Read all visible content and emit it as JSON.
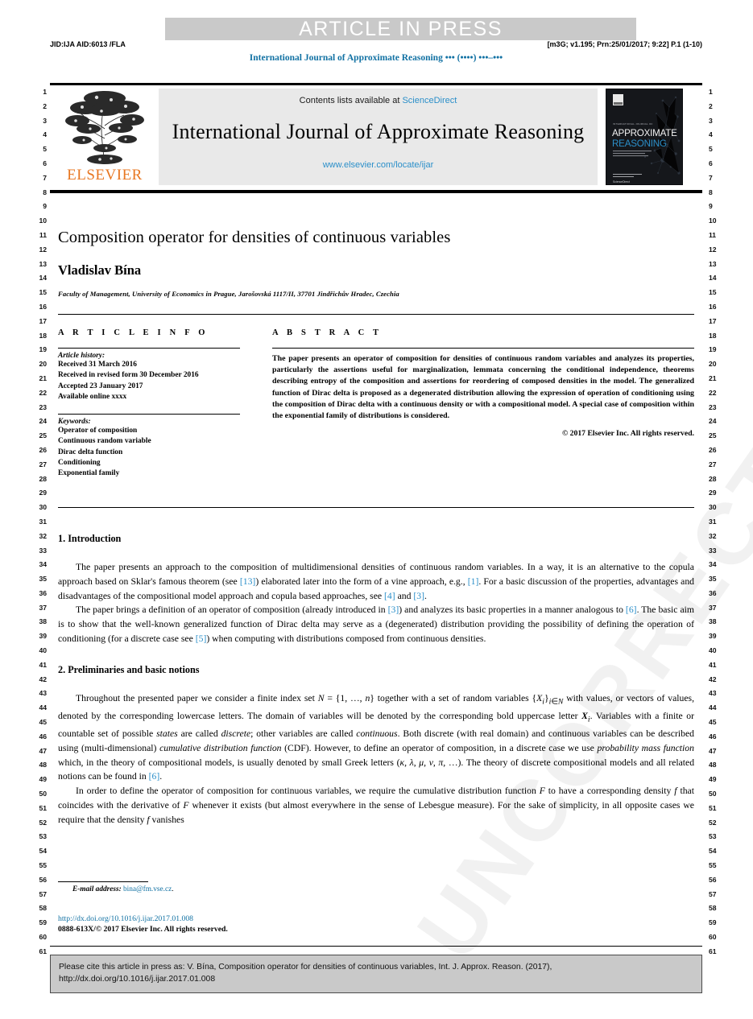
{
  "banner": {
    "text": "ARTICLE IN PRESS"
  },
  "proof_header": {
    "left": "JID:IJA   AID:6013 /FLA",
    "right": "[m3G; v1.195; Prn:25/01/2017; 9:22] P.1 (1-10)"
  },
  "journal_reference": "International Journal of Approximate Reasoning ••• (••••) •••–•••",
  "masthead": {
    "publisher": "ELSEVIER",
    "contents_prefix": "Contents lists available at ",
    "contents_link": "ScienceDirect",
    "journal_title": "International Journal of Approximate Reasoning",
    "journal_url": "www.elsevier.com/locate/ijar",
    "cover": {
      "title_line1": "APPROXIMATE",
      "title_line2": "REASONING",
      "top_label": "INTERNATIONAL JOURNAL OF"
    }
  },
  "line_numbers": {
    "first": 1,
    "last": 61
  },
  "article": {
    "title": "Composition operator for densities of continuous variables",
    "author": "Vladislav Bína",
    "affiliation": "Faculty of Management, University of Economics in Prague, Jarošovská 1117/II, 37701 Jindřichův Hradec, Czechia"
  },
  "article_info": {
    "heading": "A R T I C L E   I N F O",
    "history_label": "Article history:",
    "history": [
      "Received 31 March 2016",
      "Received in revised form 30 December 2016",
      "Accepted 23 January 2017",
      "Available online xxxx"
    ],
    "keywords_label": "Keywords:",
    "keywords": [
      "Operator of composition",
      "Continuous random variable",
      "Dirac delta function",
      "Conditioning",
      "Exponential family"
    ]
  },
  "abstract": {
    "heading": "A B S T R A C T",
    "text": "The paper presents an operator of composition for densities of continuous random variables and analyzes its properties, particularly the assertions useful for marginalization, lemmata concerning the conditional independence, theorems describing entropy of the composition and assertions for reordering of composed densities in the model. The generalized function of Dirac delta is proposed as a degenerated distribution allowing the expression of operation of conditioning using the composition of Dirac delta with a continuous density or with a compositional model. A special case of composition within the exponential family of distributions is considered.",
    "copyright": "© 2017 Elsevier Inc. All rights reserved."
  },
  "sections": [
    {
      "number_title": "1. Introduction"
    },
    {
      "number_title": "2. Preliminaries and basic notions"
    }
  ],
  "footnote": {
    "label": "E-mail address:",
    "email": "bina@fm.vse.cz",
    "email_suffix": "."
  },
  "doi": {
    "url": "http://dx.doi.org/10.1016/j.ijar.2017.01.008",
    "issn_line": "0888-613X/© 2017 Elsevier Inc. All rights reserved."
  },
  "citation_box": {
    "line1": "Please cite this article in press as: V. Bína, Composition operator for densities of continuous variables, Int. J. Approx. Reason. (2017),",
    "line2": "http://dx.doi.org/10.1016/j.ijar.2017.01.008"
  },
  "watermark": {
    "text": "UNCORRECTED PROOF"
  },
  "colors": {
    "link": "#2b8fc9",
    "reference": "#2b8fc9",
    "elsevier_orange": "#e87722",
    "banner_bg": "#c9c9c9",
    "masthead_bg": "#e9e9e9",
    "journal_ref": "#1171a3"
  }
}
